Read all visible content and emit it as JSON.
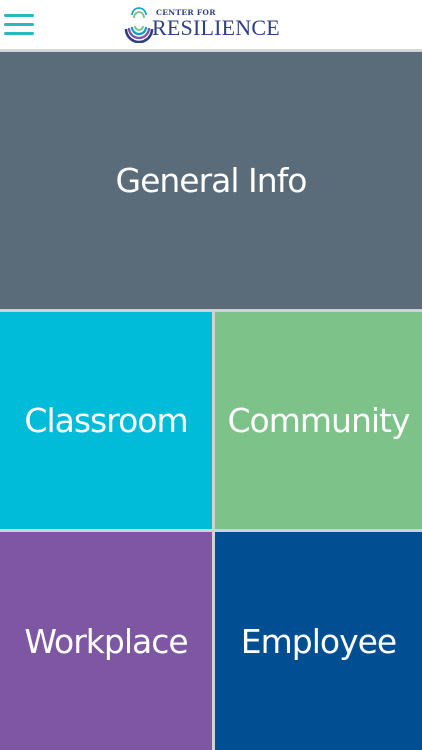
{
  "header": {
    "logo_small_text": "CENTER FOR",
    "logo_main_text": "RESILIENCE",
    "menu_icon": "hamburger-menu-icon",
    "logo_icon": "rainbow-arcs-logo-icon"
  },
  "tiles": [
    {
      "label": "General Info",
      "color": "#5a6b79"
    },
    {
      "label": "Classroom",
      "color": "#00bcd9"
    },
    {
      "label": "Community",
      "color": "#7dc288"
    },
    {
      "label": "Workplace",
      "color": "#7e57a3"
    },
    {
      "label": "Employee",
      "color": "#014e93"
    }
  ],
  "colors": {
    "menu_teal": "#2ab7c2",
    "logo_navy": "#2e3f86",
    "divider": "#cfd3d6"
  }
}
